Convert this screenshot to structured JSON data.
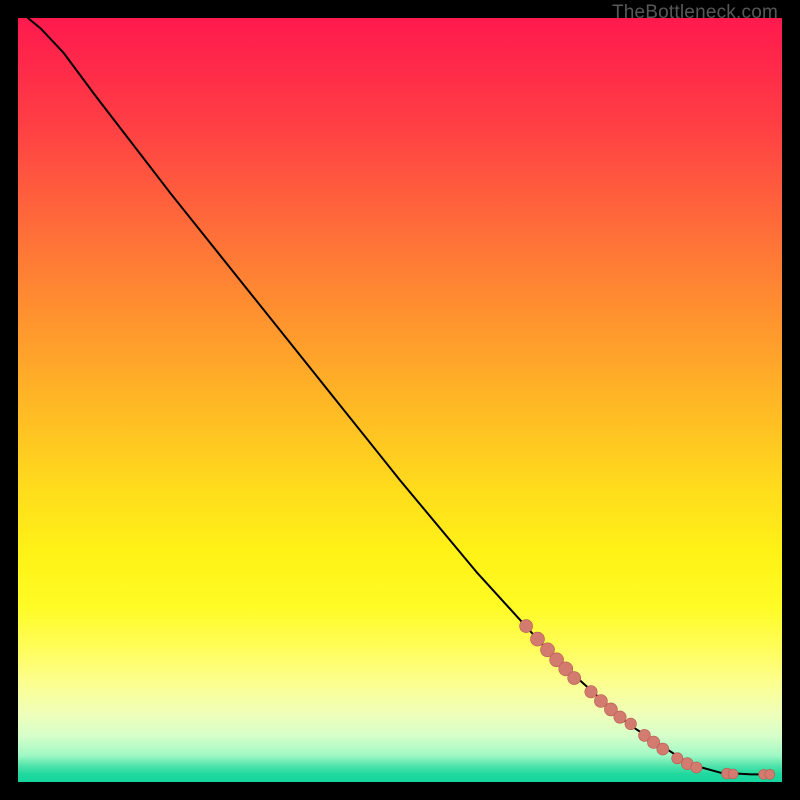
{
  "watermark": "TheBottleneck.com",
  "colors": {
    "curve": "#000000",
    "dot_fill": "#d47b6f",
    "dot_stroke": "#b45a50"
  },
  "chart_data": {
    "type": "line",
    "title": "",
    "xlabel": "",
    "ylabel": "",
    "xlim": [
      0,
      100
    ],
    "ylim": [
      0,
      100
    ],
    "curve_points": [
      {
        "x": 1.3,
        "y": 100.0
      },
      {
        "x": 3.0,
        "y": 98.6
      },
      {
        "x": 6.0,
        "y": 95.4
      },
      {
        "x": 10.0,
        "y": 90.0
      },
      {
        "x": 20.0,
        "y": 77.0
      },
      {
        "x": 30.0,
        "y": 64.5
      },
      {
        "x": 40.0,
        "y": 52.0
      },
      {
        "x": 50.0,
        "y": 39.5
      },
      {
        "x": 60.0,
        "y": 27.5
      },
      {
        "x": 70.0,
        "y": 16.5
      },
      {
        "x": 80.0,
        "y": 7.5
      },
      {
        "x": 88.0,
        "y": 2.3
      },
      {
        "x": 92.0,
        "y": 1.2
      },
      {
        "x": 96.0,
        "y": 1.0
      },
      {
        "x": 98.5,
        "y": 1.0
      }
    ],
    "dots": [
      {
        "x": 66.5,
        "y": 20.4,
        "r": 6.5
      },
      {
        "x": 68.0,
        "y": 18.7,
        "r": 7.0
      },
      {
        "x": 69.3,
        "y": 17.3,
        "r": 7.0
      },
      {
        "x": 70.5,
        "y": 16.0,
        "r": 7.0
      },
      {
        "x": 71.7,
        "y": 14.8,
        "r": 7.0
      },
      {
        "x": 72.8,
        "y": 13.6,
        "r": 6.5
      },
      {
        "x": 75.0,
        "y": 11.8,
        "r": 6.2
      },
      {
        "x": 76.3,
        "y": 10.6,
        "r": 6.5
      },
      {
        "x": 77.6,
        "y": 9.5,
        "r": 6.5
      },
      {
        "x": 78.8,
        "y": 8.5,
        "r": 6.2
      },
      {
        "x": 80.2,
        "y": 7.6,
        "r": 5.8
      },
      {
        "x": 82.0,
        "y": 6.1,
        "r": 6.0
      },
      {
        "x": 83.2,
        "y": 5.2,
        "r": 6.2
      },
      {
        "x": 84.4,
        "y": 4.3,
        "r": 6.0
      },
      {
        "x": 86.3,
        "y": 3.1,
        "r": 5.6
      },
      {
        "x": 87.6,
        "y": 2.4,
        "r": 6.0
      },
      {
        "x": 88.8,
        "y": 1.9,
        "r": 5.6
      },
      {
        "x": 92.8,
        "y": 1.1,
        "r": 5.4
      },
      {
        "x": 93.6,
        "y": 1.05,
        "r": 5.0
      },
      {
        "x": 97.6,
        "y": 1.0,
        "r": 5.0
      },
      {
        "x": 98.4,
        "y": 1.0,
        "r": 5.0
      }
    ]
  }
}
